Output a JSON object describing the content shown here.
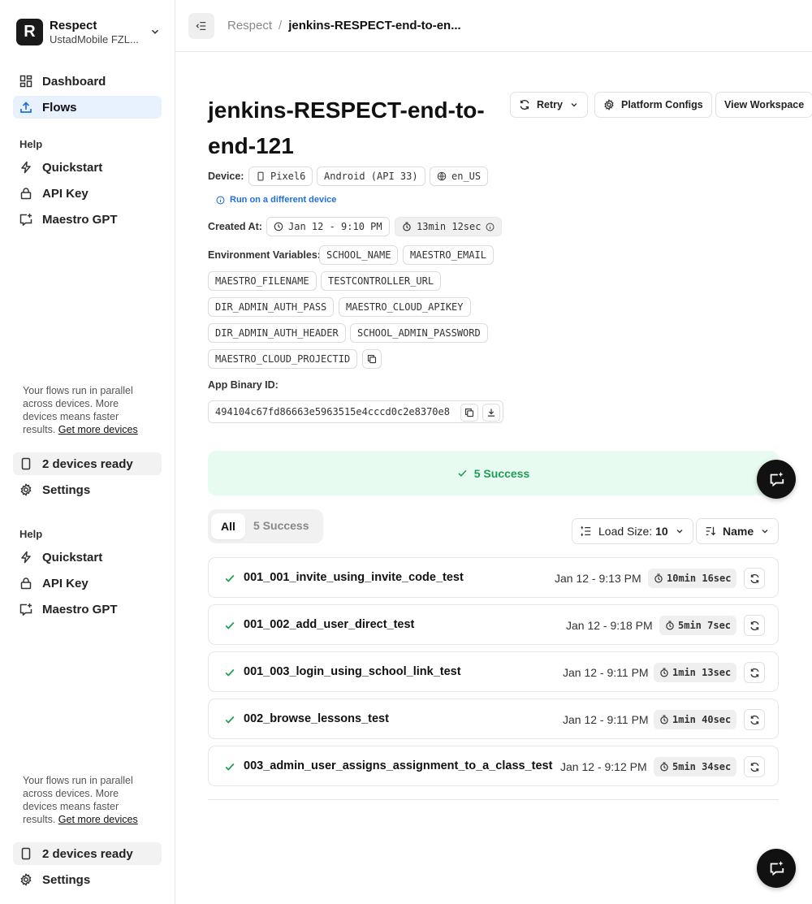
{
  "org": {
    "logo_letter": "R",
    "name": "Respect",
    "subtitle": "UstadMobile FZL..."
  },
  "nav": {
    "dashboard": "Dashboard",
    "flows": "Flows"
  },
  "help": {
    "label": "Help",
    "quickstart": "Quickstart",
    "api_key": "API Key",
    "maestro_gpt": "Maestro GPT"
  },
  "promo": {
    "text": "Your flows run in parallel across devices. More devices means faster results.",
    "link": "Get more devices"
  },
  "devices_ready": "2 devices ready",
  "settings": "Settings",
  "breadcrumb": {
    "root": "Respect",
    "separator": "/",
    "current": "jenkins-RESPECT-end-to-en..."
  },
  "upload": {
    "title": "jenkins-RESPECT-end-to-end-121",
    "actions": {
      "retry": "Retry",
      "platform_configs": "Platform Configs",
      "view_workspace": "View Workspace"
    },
    "device_label": "Device:",
    "device_model": "Pixel6",
    "device_os": "Android (API 33)",
    "device_locale": "en_US",
    "run_different_device": "Run on a different device",
    "created_label": "Created At:",
    "created_at": "Jan 12 - 9:10 PM",
    "total_duration": "13min 12sec",
    "env_label": "Environment Variables:",
    "env_vars": [
      "SCHOOL_NAME",
      "MAESTRO_EMAIL",
      "MAESTRO_FILENAME",
      "TESTCONTROLLER_URL",
      "DIR_ADMIN_AUTH_PASS",
      "MAESTRO_CLOUD_APIKEY",
      "DIR_ADMIN_AUTH_HEADER",
      "SCHOOL_ADMIN_PASSWORD",
      "MAESTRO_CLOUD_PROJECTID"
    ],
    "binary_label": "App Binary ID:",
    "binary_id": "494104c67fd86663e5963515e4cccd0c2e8370e8"
  },
  "summary": {
    "success_text": "5 Success",
    "success_color": "#1f9d55"
  },
  "filters": {
    "all": "All",
    "success": "5 Success"
  },
  "sort": {
    "load_size_label": "Load Size:",
    "load_size_value": "10",
    "name": "Name"
  },
  "flows": [
    {
      "name": "001_001_invite_using_invite_code_test",
      "time": "Jan 12 - 9:13 PM",
      "duration": "10min 16sec"
    },
    {
      "name": "001_002_add_user_direct_test",
      "time": "Jan 12 - 9:18 PM",
      "duration": "5min 7sec"
    },
    {
      "name": "001_003_login_using_school_link_test",
      "time": "Jan 12 - 9:11 PM",
      "duration": "1min 13sec"
    },
    {
      "name": "002_browse_lessons_test",
      "time": "Jan 12 - 9:11 PM",
      "duration": "1min 40sec"
    },
    {
      "name": "003_admin_user_assigns_assignment_to_a_class_test",
      "time": "Jan 12 - 9:12 PM",
      "duration": "5min 34sec"
    }
  ],
  "colors": {
    "accent": "#1e6fe0",
    "active_nav_bg": "#e8f1fe",
    "success_bg": "#e8fbf1"
  }
}
